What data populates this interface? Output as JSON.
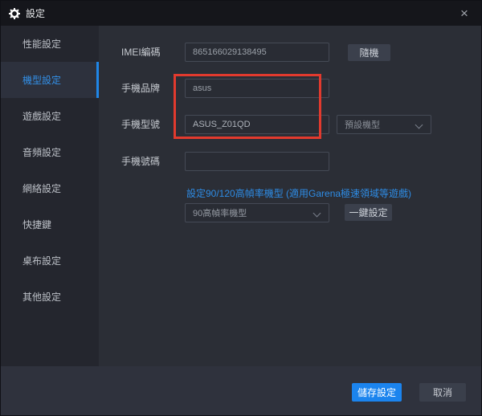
{
  "window": {
    "title": "設定"
  },
  "colors": {
    "accent_blue": "#1f86e8",
    "link_blue": "#2e8ce5",
    "annotation_red": "#e23a2e"
  },
  "icons": {
    "close": "×"
  },
  "sidebar": {
    "items": [
      {
        "label": "性能設定"
      },
      {
        "label": "機型設定",
        "selected": true
      },
      {
        "label": "遊戲設定"
      },
      {
        "label": "音頻設定"
      },
      {
        "label": "網絡設定"
      },
      {
        "label": "快捷鍵"
      },
      {
        "label": "桌布設定"
      },
      {
        "label": "其他設定"
      }
    ]
  },
  "form": {
    "imei": {
      "label": "IMEI編碼",
      "value": "865166029138495",
      "random_button": "隨機"
    },
    "brand": {
      "label": "手機品牌",
      "value": "asus"
    },
    "model": {
      "label": "手機型號",
      "value": "ASUS_Z01QD",
      "preset_dropdown": "預設機型"
    },
    "phone_number": {
      "label": "手機號碼",
      "value": ""
    },
    "high_fps": {
      "link": "設定90/120高幀率機型 (適用Garena極速領域等遊戲)",
      "dropdown": "90高幀率機型",
      "apply_button": "一鍵設定"
    }
  },
  "footer": {
    "save_label": "儲存設定",
    "cancel_label": "取消"
  }
}
